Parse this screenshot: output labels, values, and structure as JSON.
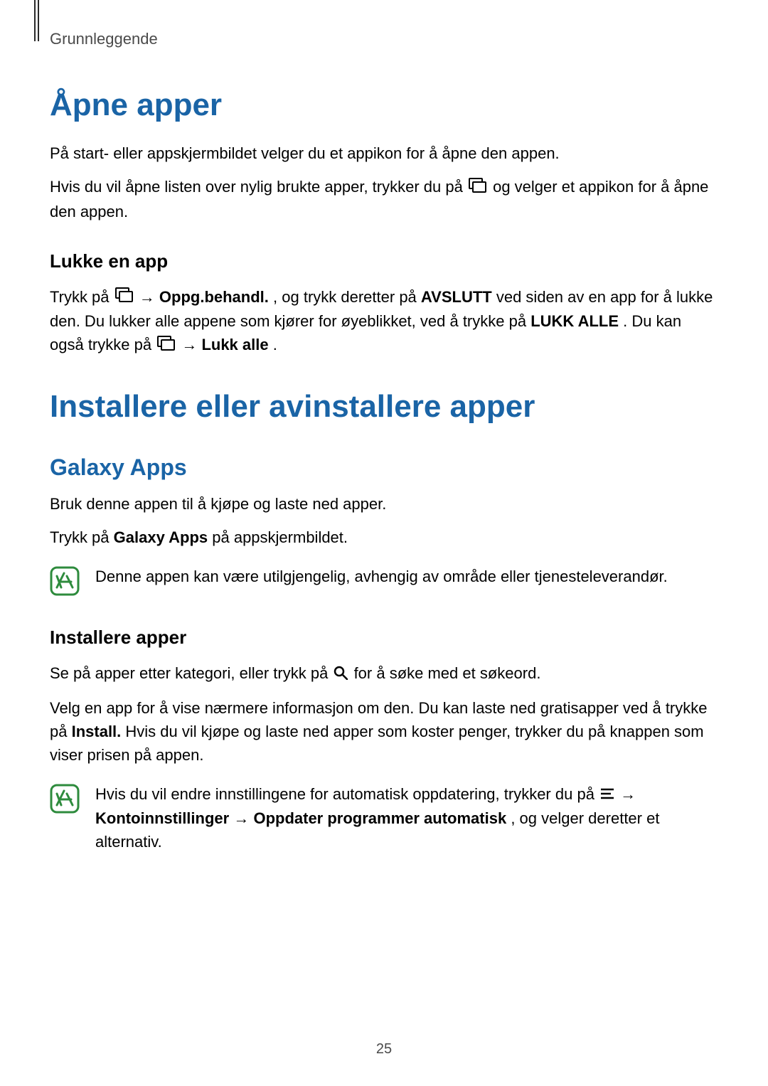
{
  "header": {
    "breadcrumb": "Grunnleggende"
  },
  "section1": {
    "title": "Åpne apper",
    "p1": "På start- eller appskjermbildet velger du et appikon for å åpne den appen.",
    "p2a": "Hvis du vil åpne listen over nylig brukte apper, trykker du på ",
    "p2b": " og velger et appikon for å åpne den appen.",
    "h3": "Lukke en app",
    "p3a": "Trykk på ",
    "p3arrow1": " → ",
    "p3b": "Oppg.behandl.",
    "p3c": ", og trykk deretter på ",
    "p3d": "AVSLUTT",
    "p3e": " ved siden av en app for å lukke den. Du lukker alle appene som kjører for øyeblikket, ved å trykke på ",
    "p3f": "LUKK ALLE",
    "p3g": ". Du kan også trykke på ",
    "p3arrow2": " → ",
    "p3h": "Lukk alle",
    "p3i": "."
  },
  "section2": {
    "title": "Installere eller avinstallere apper",
    "h2": "Galaxy Apps",
    "p1": "Bruk denne appen til å kjøpe og laste ned apper.",
    "p2a": "Trykk på ",
    "p2b": "Galaxy Apps",
    "p2c": " på appskjermbildet.",
    "note1": "Denne appen kan være utilgjengelig, avhengig av område eller tjenesteleverandør.",
    "h3": "Installere apper",
    "p3a": "Se på apper etter kategori, eller trykk på ",
    "p3b": " for å søke med et søkeord.",
    "p4a": "Velg en app for å vise nærmere informasjon om den. Du kan laste ned gratisapper ved å trykke på ",
    "p4b": "Install.",
    "p4c": " Hvis du vil kjøpe og laste ned apper som koster penger, trykker du på knappen som viser prisen på appen.",
    "note2a": "Hvis du vil endre innstillingene for automatisk oppdatering, trykker du på ",
    "note2arrow": " → ",
    "note2b": "Kontoinnstillinger",
    "note2arrow2": " → ",
    "note2c": "Oppdater programmer automatisk",
    "note2d": ", og velger deretter et alternativ."
  },
  "footer": {
    "page": "25"
  }
}
